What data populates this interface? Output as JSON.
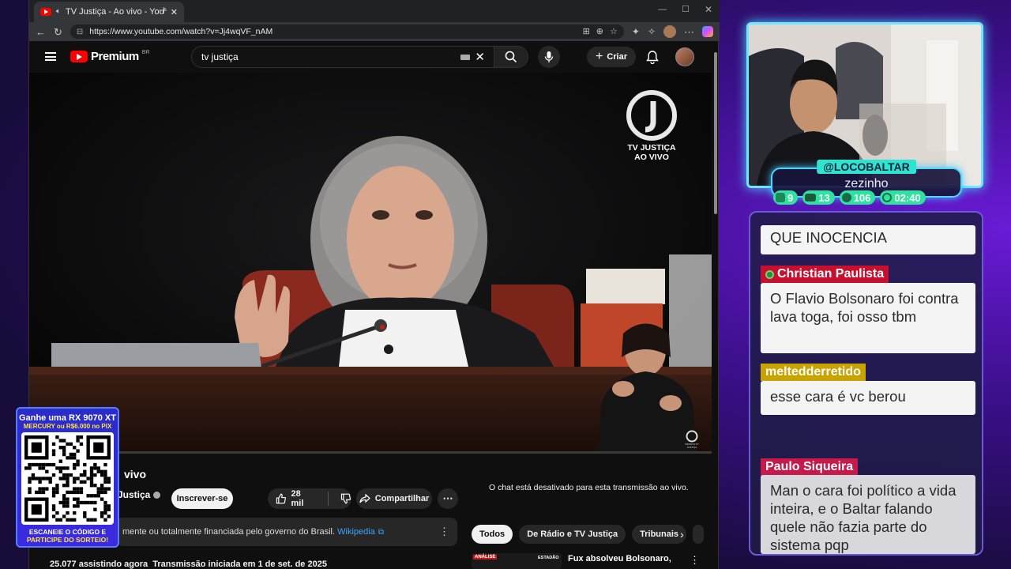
{
  "browser": {
    "tab_title": "TV Justiça - Ao vivo - YouTub",
    "url": "https://www.youtube.com/watch?v=Jj4wqVF_nAM"
  },
  "youtube": {
    "logo_text": "Premium",
    "logo_region": "BR",
    "search_value": "tv justiça",
    "create_label": "Criar",
    "video_title_partial": "vivo",
    "channel_partial": "Justiça",
    "subscribe_label": "Inscrever-se",
    "likes": "28 mil",
    "share_label": "Compartilhar",
    "gov_notice": "mente ou totalmente financiada pelo governo do Brasil.",
    "gov_link": "Wikipedia",
    "chat_disabled": "O chat está desativado para esta transmissão ao vivo.",
    "chips": [
      "Todos",
      "De Rádio e TV Justiça",
      "Tribunais"
    ],
    "stats_line": "25.077 assistindo agora  Transmissão iniciada em 1 de set. de 2025",
    "rec_title": "Fux absolveu Bolsonaro,",
    "rec_badge": "ANÁLISE",
    "rec_source": "ESTADÃO"
  },
  "overlay_logo": {
    "line1": "TV JUSTIÇA",
    "line2": "AO VIVO",
    "small": "RÁDIO E TV JUSTIÇA"
  },
  "stream": {
    "handle": "@LOCOBALTAR",
    "subtitle": "zezinho",
    "stats": [
      {
        "icon": "twitch-icon",
        "value": "9"
      },
      {
        "icon": "youtube-icon",
        "value": "13"
      },
      {
        "icon": "kick-icon",
        "value": "106"
      },
      {
        "icon": "clock-icon",
        "value": "02:40"
      }
    ]
  },
  "chat": [
    {
      "name": "",
      "text": "QUE INOCENCIA",
      "color": "#000000"
    },
    {
      "name": "Christian Paulista",
      "text": "O Flavio Bolsonaro foi contra lava toga, foi osso tbm",
      "color": "#c8102e"
    },
    {
      "name": "meltedderretido",
      "text": "esse cara é vc berou",
      "color": "#c9a400"
    },
    {
      "name": "Paulo Siqueira",
      "text": "Man o cara foi político a vida inteira, e o Baltar falando quele não fazia parte do sistema pqp",
      "color": "#c81a4a"
    }
  ],
  "promo": {
    "headline": "Ganhe uma RX 9070 XT",
    "sub": "MERCURY ou R$6.000 no PIX",
    "cta1": "ESCANEIE O CÓDIGO E",
    "cta2": "PARTICIPE DO SORTEIO!"
  }
}
